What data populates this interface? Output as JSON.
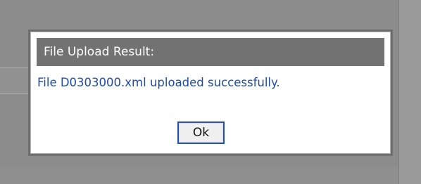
{
  "dialog": {
    "title": "File Upload Result:",
    "message": "File D0303000.xml uploaded successfully.",
    "ok_label": "Ok"
  }
}
